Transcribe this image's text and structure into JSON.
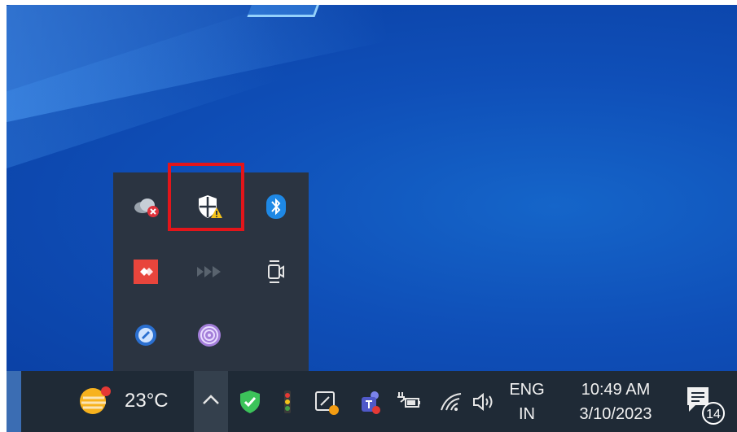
{
  "taskbar": {
    "weather": {
      "temperature": "23°C",
      "icon": "weather-sun-cloud-icon"
    },
    "tray_chevron": {
      "icon": "chevron-up-icon"
    },
    "pinned_tray_icons": [
      "security-check-icon",
      "traffic-light-icon",
      "pen-workspace-icon",
      "teams-icon",
      "battery-charging-icon",
      "wifi-icon",
      "volume-icon"
    ],
    "language": {
      "line1": "ENG",
      "line2": "IN"
    },
    "clock": {
      "time": "10:49 AM",
      "date": "3/10/2023"
    },
    "notifications": {
      "count": "14",
      "icon": "action-center-icon"
    }
  },
  "tray_popup": {
    "icons": [
      "onedrive-error-icon",
      "windows-security-warning-icon",
      "bluetooth-icon",
      "anydesk-icon",
      "media-forward-icon",
      "camera-meet-icon",
      "app-blue-icon",
      "tor-onion-icon"
    ],
    "highlighted": "windows-security-warning-icon"
  },
  "colors": {
    "highlight": "#e3151a",
    "taskbar": "#1f2a36",
    "popup": "#2b3441"
  }
}
